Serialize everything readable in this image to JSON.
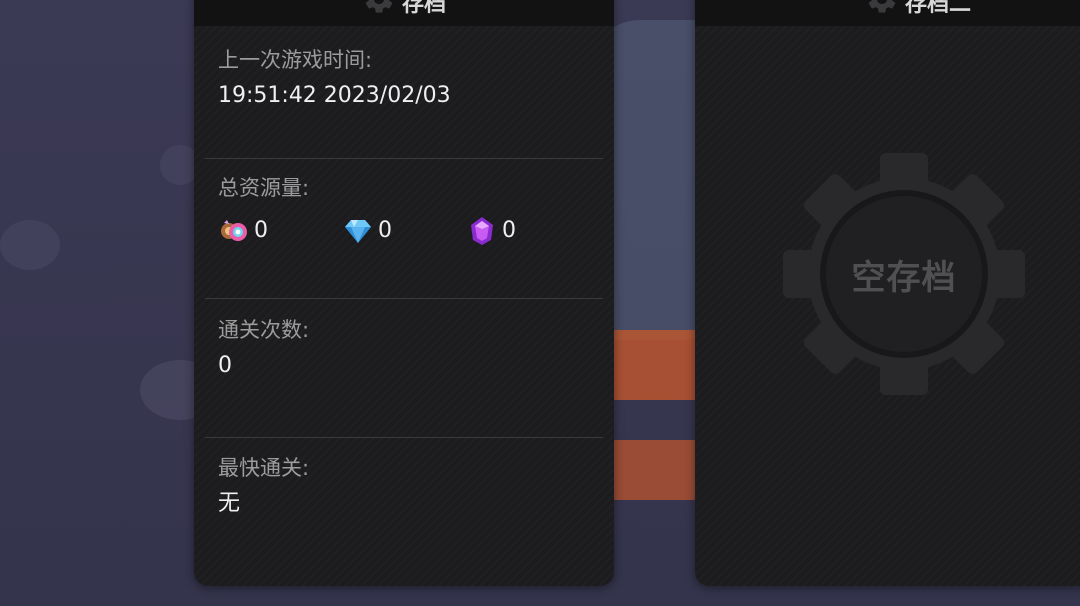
{
  "slot_one": {
    "title": "存档",
    "last_played_label": "上一次游戏时间:",
    "last_played_value": "19:51:42 2023/02/03",
    "resources_label": "总资源量:",
    "resources": [
      {
        "icon": "candy-icon",
        "value": "0"
      },
      {
        "icon": "blue-gem-icon",
        "value": "0"
      },
      {
        "icon": "purple-crystal-icon",
        "value": "0"
      }
    ],
    "clears_label": "通关次数:",
    "clears_value": "0",
    "fastest_label": "最快通关:",
    "fastest_value": "无"
  },
  "slot_two": {
    "title": "存档二",
    "empty_label": "空存档"
  },
  "colors": {
    "panel": "#1c1c1e",
    "header": "#121213",
    "label": "#9c9c9c",
    "value": "#f0f0f0",
    "gem_blue": "#3fa7e6",
    "crystal_purple": "#b23ce0"
  }
}
